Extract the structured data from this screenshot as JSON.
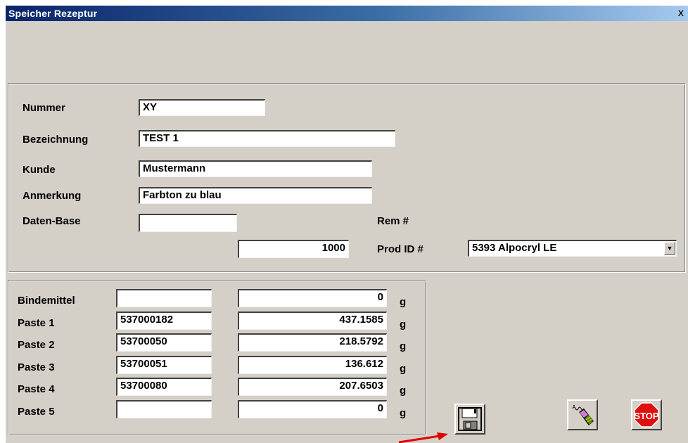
{
  "window": {
    "title": "Speicher Rezeptur",
    "close_label": "x"
  },
  "header": {
    "nummer_label": "Nummer",
    "nummer_value": "XY",
    "bezeichnung_label": "Bezeichnung",
    "bezeichnung_value": "TEST 1",
    "kunde_label": "Kunde",
    "kunde_value": "Mustermann",
    "anmerkung_label": "Anmerkung",
    "anmerkung_value": "Farbton zu blau",
    "datenbase_label": "Daten-Base",
    "datenbase_value": "",
    "rem_label": "Rem #",
    "amount_value": "1000",
    "prodid_label": "Prod ID #",
    "prodid_value": "5393 Alpocryl LE"
  },
  "components": {
    "unit": "g",
    "rows": [
      {
        "label": "Bindemittel",
        "code": "",
        "amount": "0"
      },
      {
        "label": "Paste 1",
        "code": "537000182",
        "amount": "437.1585"
      },
      {
        "label": "Paste 2",
        "code": "53700050",
        "amount": "218.5792"
      },
      {
        "label": "Paste 3",
        "code": "53700051",
        "amount": "136.612"
      },
      {
        "label": "Paste 4",
        "code": "53700080",
        "amount": "207.6503"
      },
      {
        "label": "Paste 5",
        "code": "",
        "amount": "0"
      }
    ]
  },
  "toolbar": {
    "save_icon": "floppy-disk-icon",
    "tool_icon": "eraser-brush-icon",
    "stop_icon": "stop-sign-icon",
    "stop_text": "STOP"
  },
  "colors": {
    "title_bar": "#0a246a",
    "window_bg": "#d4d0c8",
    "stop_red": "#e01010",
    "annotation_arrow": "#e00000"
  }
}
